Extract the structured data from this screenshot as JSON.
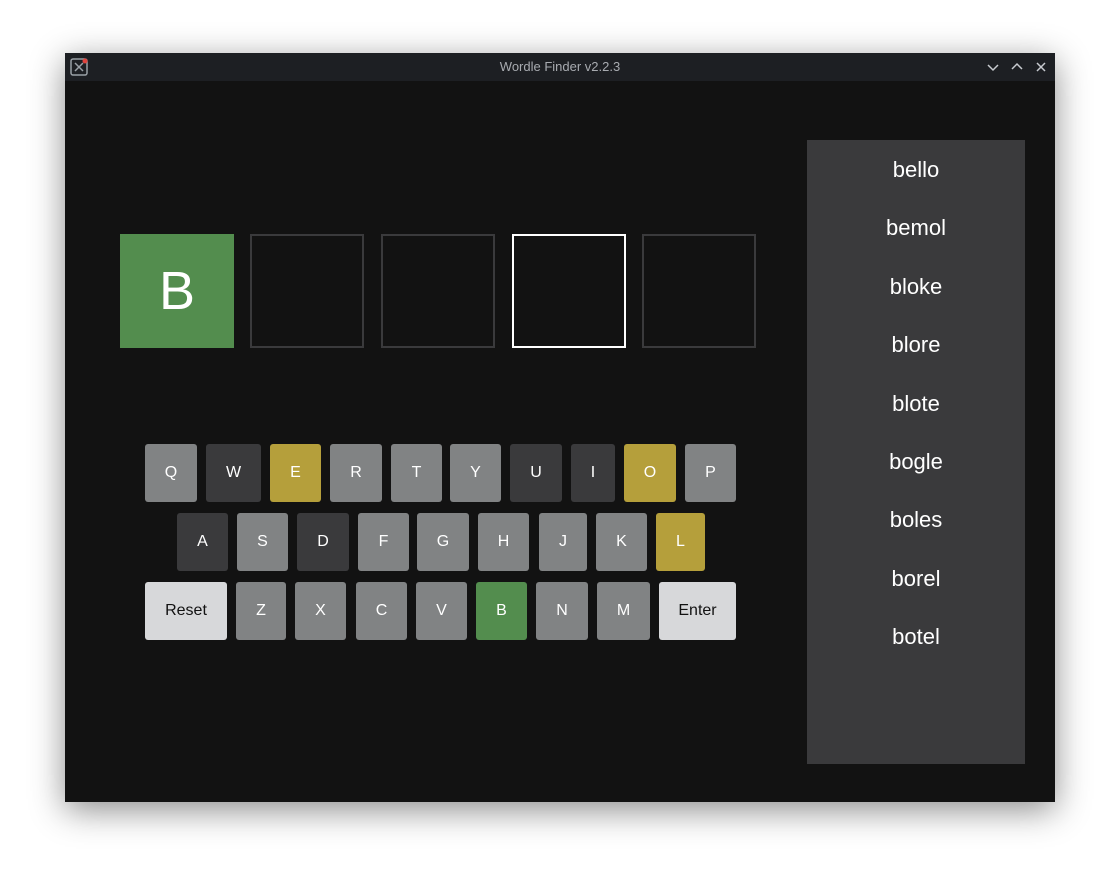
{
  "window": {
    "title": "Wordle Finder v2.2.3"
  },
  "colors": {
    "correct": "#538d4e",
    "present": "#b59f3b",
    "absent": "#3a3a3c",
    "unused": "#818384",
    "action": "#d7d8da",
    "background": "#121212",
    "panel": "#3a3a3c"
  },
  "board": {
    "tiles": [
      {
        "letter": "B",
        "state": "correct"
      },
      {
        "letter": "",
        "state": "empty"
      },
      {
        "letter": "",
        "state": "empty"
      },
      {
        "letter": "",
        "state": "active"
      },
      {
        "letter": "",
        "state": "empty"
      }
    ]
  },
  "keyboard": {
    "row1": [
      {
        "label": "Q",
        "state": "unused"
      },
      {
        "label": "W",
        "state": "absent"
      },
      {
        "label": "E",
        "state": "present"
      },
      {
        "label": "R",
        "state": "unused"
      },
      {
        "label": "T",
        "state": "unused"
      },
      {
        "label": "Y",
        "state": "unused"
      },
      {
        "label": "U",
        "state": "absent"
      },
      {
        "label": "I",
        "state": "absent"
      },
      {
        "label": "O",
        "state": "present"
      },
      {
        "label": "P",
        "state": "unused"
      }
    ],
    "row2": [
      {
        "label": "A",
        "state": "absent"
      },
      {
        "label": "S",
        "state": "unused"
      },
      {
        "label": "D",
        "state": "absent"
      },
      {
        "label": "F",
        "state": "unused"
      },
      {
        "label": "G",
        "state": "unused"
      },
      {
        "label": "H",
        "state": "unused"
      },
      {
        "label": "J",
        "state": "unused"
      },
      {
        "label": "K",
        "state": "unused"
      },
      {
        "label": "L",
        "state": "present"
      }
    ],
    "row3": [
      {
        "label": "Reset",
        "state": "action"
      },
      {
        "label": "Z",
        "state": "unused"
      },
      {
        "label": "X",
        "state": "unused"
      },
      {
        "label": "C",
        "state": "unused"
      },
      {
        "label": "V",
        "state": "unused"
      },
      {
        "label": "B",
        "state": "correct"
      },
      {
        "label": "N",
        "state": "unused"
      },
      {
        "label": "M",
        "state": "unused"
      },
      {
        "label": "Enter",
        "state": "action"
      }
    ]
  },
  "suggestions": [
    "bello",
    "bemol",
    "bloke",
    "blore",
    "blote",
    "bogle",
    "boles",
    "borel",
    "botel"
  ]
}
